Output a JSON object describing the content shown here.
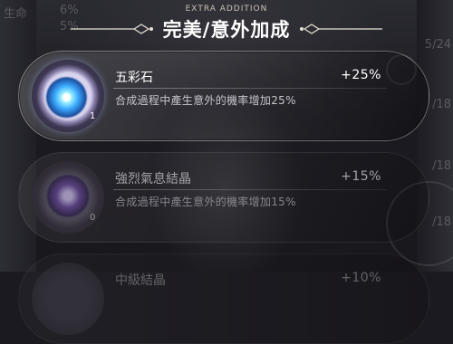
{
  "background": {
    "left_top": "生命",
    "left_pct_1": "6%",
    "left_pct_2": "5%",
    "right_1": "5/24",
    "right_2": "/18",
    "right_3": "/18",
    "right_4": "/18"
  },
  "header": {
    "subtitle": "EXTRA ADDITION",
    "title": "完美/意外加成"
  },
  "items": [
    {
      "name": "五彩石",
      "bonus": "+25%",
      "description": "合成過程中產生意外的機率增加25%",
      "count": "1",
      "icon": "rainbow-stone-icon"
    },
    {
      "name": "強烈氣息結晶",
      "bonus": "+15%",
      "description": "合成過程中產生意外的機率增加15%",
      "count": "0",
      "icon": "strong-aura-crystal-icon"
    },
    {
      "name": "中級結晶",
      "bonus": "+10%",
      "description": "",
      "count": "",
      "icon": "crystal-icon"
    }
  ],
  "colors": {
    "background": "#1b1a20",
    "text": "#ffffff",
    "muted_text": "#c8c4cc"
  }
}
